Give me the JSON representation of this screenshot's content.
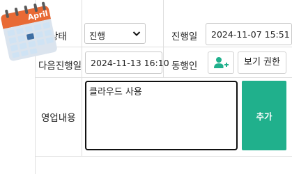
{
  "form": {
    "status_label": "상태",
    "status_value": "진행",
    "progress_date_label": "진행일",
    "progress_date_value": "2024-11-07 15:51",
    "next_date_label": "다음진행일",
    "next_date_value": "2024-11-13 16:10",
    "companion_label": "동행인",
    "view_permission_label": "보기 권한",
    "sales_content_label": "영업내용",
    "sales_content_value": "클라우드 사용",
    "add_label": "추가"
  },
  "calendar_icon": {
    "name": "calendar-icon",
    "month": "April"
  },
  "icons": {
    "add_person": "add-person-icon",
    "dropdown": "chevron-down-icon"
  },
  "colors": {
    "accent": "#20b08c",
    "calendar_header": "#e86a35",
    "calendar_cells": "#cfe3f4"
  }
}
